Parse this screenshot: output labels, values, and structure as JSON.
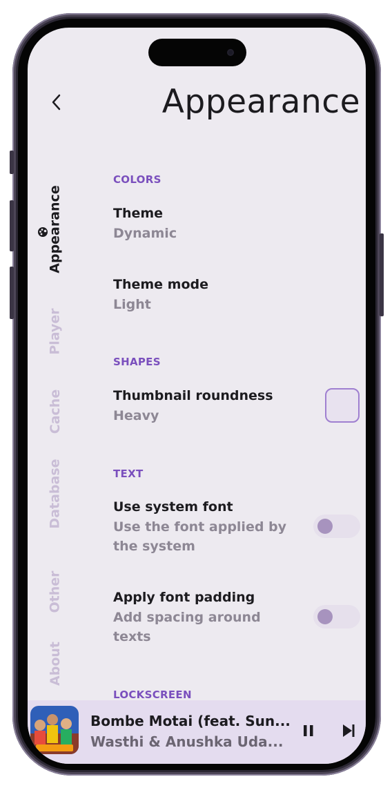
{
  "header": {
    "title": "Appearance"
  },
  "tabs": [
    {
      "label": "Appearance",
      "active": true
    },
    {
      "label": "Player"
    },
    {
      "label": "Cache"
    },
    {
      "label": "Database"
    },
    {
      "label": "Other"
    },
    {
      "label": "About"
    }
  ],
  "sections": {
    "colors": "COLORS",
    "shapes": "SHAPES",
    "text": "TEXT",
    "lockscreen": "LOCKSCREEN"
  },
  "settings": {
    "theme": {
      "title": "Theme",
      "value": "Dynamic"
    },
    "theme_mode": {
      "title": "Theme mode",
      "value": "Light"
    },
    "thumbnail_roundness": {
      "title": "Thumbnail roundness",
      "value": "Heavy"
    },
    "system_font": {
      "title": "Use system font",
      "description": "Use the font applied by the system",
      "enabled": false
    },
    "font_padding": {
      "title": "Apply font padding",
      "description": "Add spacing around texts",
      "enabled": false
    }
  },
  "player": {
    "title": "Bombe Motai (feat. Sun...",
    "artist": "Wasthi & Anushka Uda...",
    "pause_icon": "pause-icon",
    "next_icon": "skip-next-icon"
  },
  "colors": {
    "accent": "#7a4fbd",
    "background": "#edeaf0",
    "player_background": "#e4dcef"
  }
}
